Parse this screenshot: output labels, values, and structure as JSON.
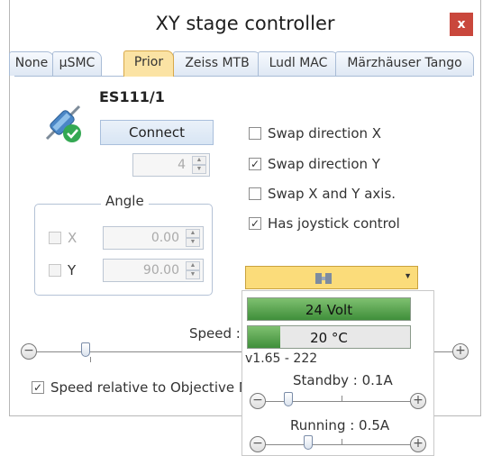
{
  "window": {
    "title": "XY stage controller",
    "close_label": "x"
  },
  "tabs": [
    "None",
    "µSMC",
    "Prior",
    "Zeiss MTB",
    "Ludl MAC",
    "Märzhäuser Tango"
  ],
  "active_tab": "Prior",
  "device": {
    "name": "ES111/1",
    "icon": "connected-plug-icon"
  },
  "connect_button": "Connect",
  "port": {
    "value": "4"
  },
  "angle": {
    "label": "Angle",
    "x": {
      "label": "X",
      "value": "0.00",
      "checked": false,
      "enabled": false
    },
    "y": {
      "label": "Y",
      "value": "90.00",
      "checked": false,
      "enabled": false
    }
  },
  "options": [
    {
      "label": "Swap direction X",
      "checked": false
    },
    {
      "label": "Swap direction Y",
      "checked": true
    },
    {
      "label": "Swap X and Y axis.",
      "checked": false
    },
    {
      "label": "Has joystick control",
      "checked": true
    }
  ],
  "speed": {
    "label": "Speed :"
  },
  "speed_relative": {
    "label": "Speed relative to Objective M",
    "checked": true
  },
  "status_popup": {
    "voltage": {
      "label": "24 Volt",
      "level": 1.0
    },
    "temperature": {
      "label": "20 °C",
      "level": 0.2
    },
    "version": "v1.65 - 222",
    "standby": {
      "label": "Standby : 0.1A"
    },
    "running": {
      "label": "Running : 0.5A"
    }
  }
}
